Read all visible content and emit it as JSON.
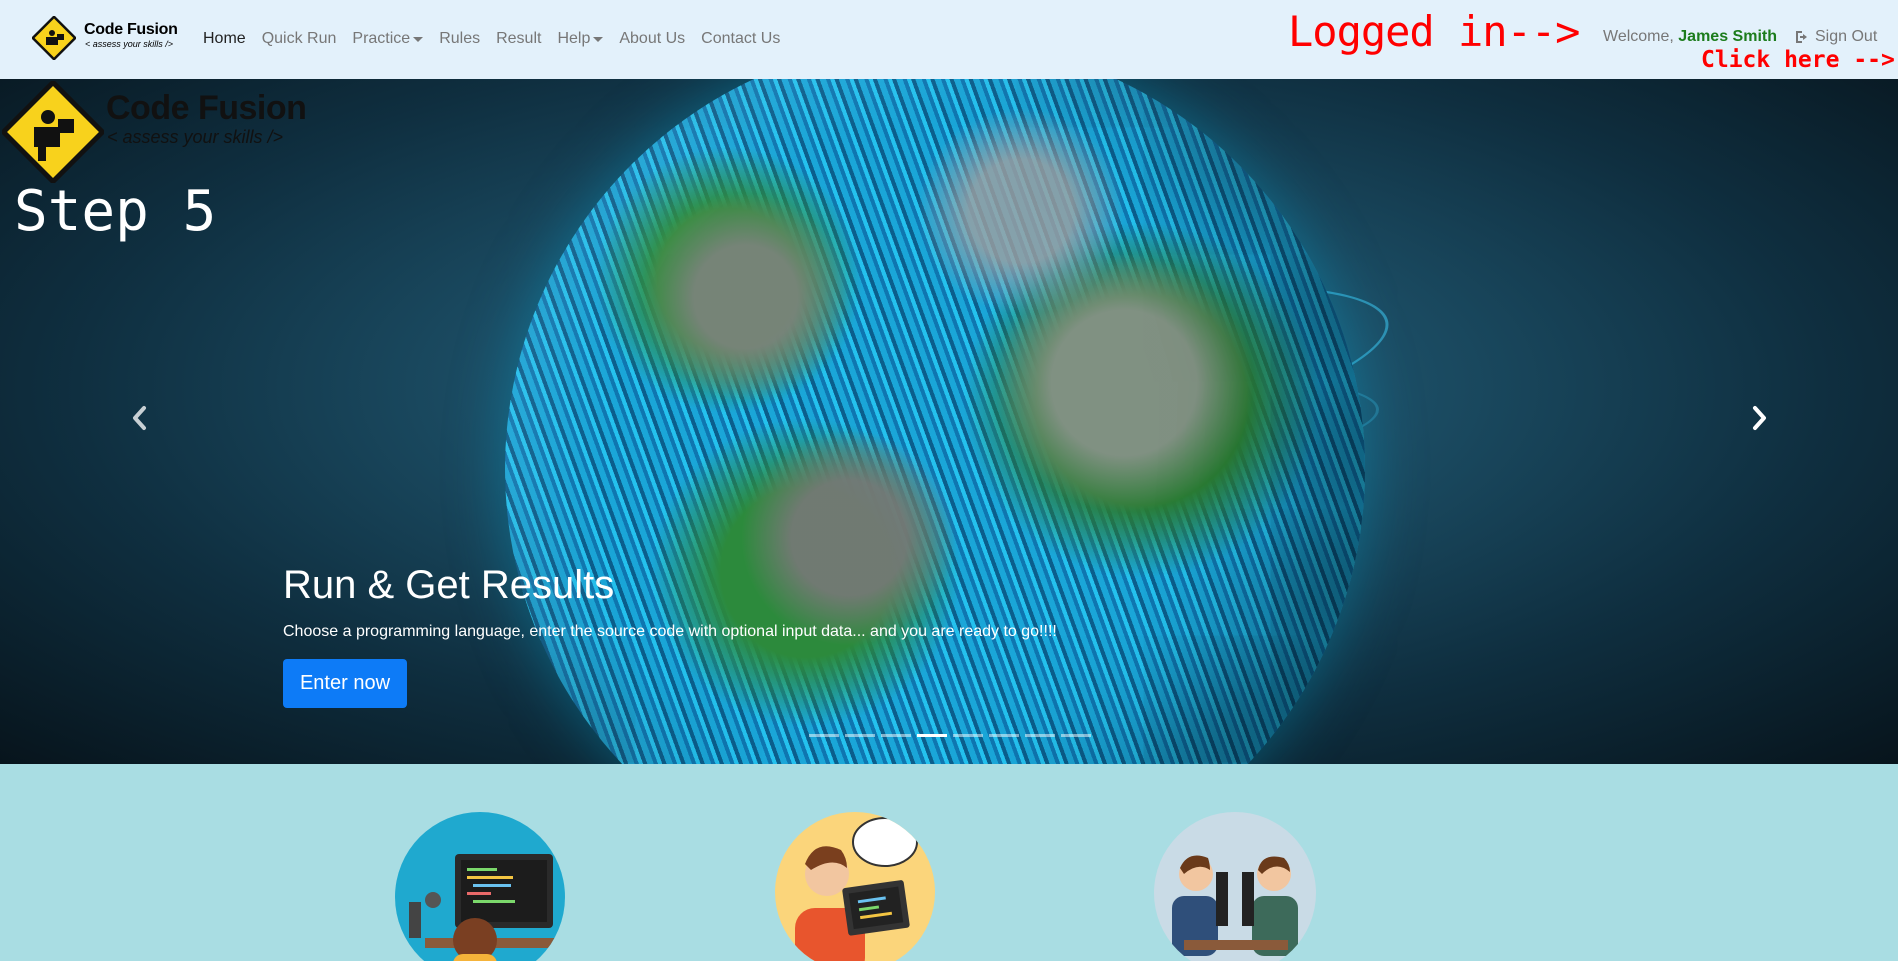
{
  "brand": {
    "title": "Code Fusion",
    "tagline": "< assess your skills />"
  },
  "nav": {
    "items": [
      {
        "label": "Home",
        "active": true,
        "dropdown": false
      },
      {
        "label": "Quick Run",
        "active": false,
        "dropdown": false
      },
      {
        "label": "Practice",
        "active": false,
        "dropdown": true
      },
      {
        "label": "Rules",
        "active": false,
        "dropdown": false
      },
      {
        "label": "Result",
        "active": false,
        "dropdown": false
      },
      {
        "label": "Help",
        "active": false,
        "dropdown": true
      },
      {
        "label": "About Us",
        "active": false,
        "dropdown": false
      },
      {
        "label": "Contact Us",
        "active": false,
        "dropdown": false
      }
    ]
  },
  "annotations": {
    "logged_in": "Logged in-->",
    "click_here": "Click here -->"
  },
  "user": {
    "welcome_prefix": "Welcome, ",
    "name": "James Smith",
    "signout_label": "Sign Out",
    "signout_icon": "sign-out-icon"
  },
  "hero": {
    "step_label": "Step 5",
    "caption_title": "Run & Get Results",
    "caption_text": "Choose a programming language, enter the source code with optional input data... and you are ready to go!!!!",
    "cta_label": "Enter now",
    "indicators_total": 8,
    "active_indicator": 4
  },
  "colors": {
    "navbar_bg": "#e3f1fb",
    "accent": "#0d7bf7",
    "annotation": "#ff0000",
    "username": "#1c7c1c",
    "page_bg": "#a9dde3"
  },
  "features": [
    {
      "icon": "developer-desk-icon"
    },
    {
      "icon": "coder-laptop-icon"
    },
    {
      "icon": "pair-programming-icon"
    }
  ]
}
